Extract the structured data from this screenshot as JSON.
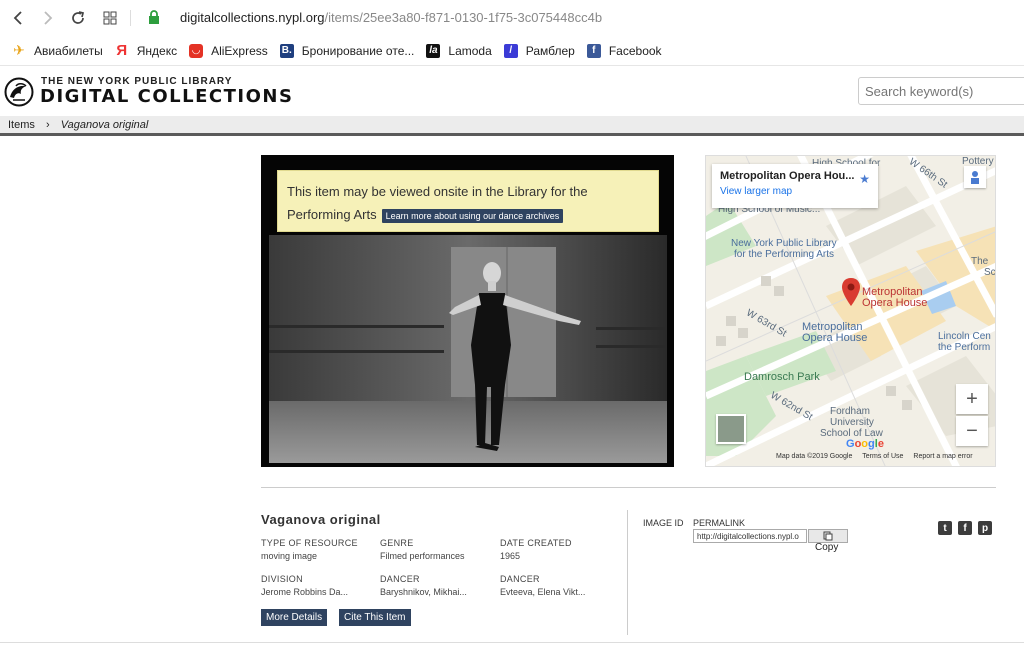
{
  "browser": {
    "url_host": "digitalcollections.nypl.org",
    "url_path": "/items/25ee3a80-f871-0130-1f75-3c075448cc4b"
  },
  "bookmarks": [
    {
      "label": "Авиабилеты",
      "icon": "plane-icon",
      "color": "#e8a317"
    },
    {
      "label": "Яндекс",
      "icon": "yandex-icon",
      "color": "#e33"
    },
    {
      "label": "AliExpress",
      "icon": "aliexpress-icon",
      "color": "#e43225"
    },
    {
      "label": "Бронирование оте...",
      "icon": "booking-icon",
      "color": "#1f3f7f"
    },
    {
      "label": "Lamoda",
      "icon": "lamoda-icon",
      "color": "#111111"
    },
    {
      "label": "Рамблер",
      "icon": "rambler-icon",
      "color": "#3b3bd6"
    },
    {
      "label": "Facebook",
      "icon": "facebook-icon",
      "color": "#3b5998"
    }
  ],
  "site": {
    "logo_small": "THE NEW YORK PUBLIC LIBRARY",
    "logo_big": "DIGITAL COLLECTIONS",
    "search_placeholder": "Search keyword(s)"
  },
  "breadcrumb": {
    "items_label": "Items",
    "current": "Vaganova original"
  },
  "player": {
    "notice_text": "This item may be viewed onsite in the Library for the Performing Arts",
    "notice_button": "Learn more about using our dance archives"
  },
  "map": {
    "place_title": "Metropolitan Opera Hou...",
    "view_larger": "View larger map",
    "labels": {
      "hs_music": "High School for",
      "hs_music2": "High School of Music...",
      "nypl": "New York Public Library",
      "nypl2": "for the Performing Arts",
      "met_red": "Metropolitan",
      "met_red2": "Opera House",
      "met": "Metropolitan",
      "met2": "Opera House",
      "lincoln": "Lincoln Cen",
      "lincoln2": "the Perform",
      "damrosch": "Damrosch Park",
      "fordham": "Fordham",
      "fordham2": "University",
      "fordham3": "School of Law",
      "w66": "W 66th St",
      "w63": "W 63rd St",
      "w62": "W 62nd St",
      "pottery": "Pottery",
      "the": "The",
      "sc": "Sc"
    },
    "zoom_in": "+",
    "zoom_out": "−",
    "footer": [
      "Map data ©2019 Google",
      "Terms of Use",
      "Report a map error"
    ]
  },
  "item": {
    "title": "Vaganova original",
    "fields": [
      {
        "key": "TYPE OF RESOURCE",
        "value": "moving image"
      },
      {
        "key": "GENRE",
        "value": "Filmed performances"
      },
      {
        "key": "DATE CREATED",
        "value": "1965"
      },
      {
        "key": "DIVISION",
        "value": "Jerome Robbins Da..."
      },
      {
        "key": "DANCER",
        "value": "Baryshnikov, Mikhai..."
      },
      {
        "key": "DANCER",
        "value": "Evteeva, Elena Vikt..."
      }
    ],
    "more_details": "More Details",
    "cite": "Cite This Item",
    "image_id_label": "IMAGE ID",
    "permalink_label": "PERMALINK",
    "permalink_value": "http://digitalcollections.nypl.o",
    "copy_label": "Copy"
  },
  "social": [
    "twitter-icon",
    "facebook-icon",
    "pinterest-icon"
  ]
}
